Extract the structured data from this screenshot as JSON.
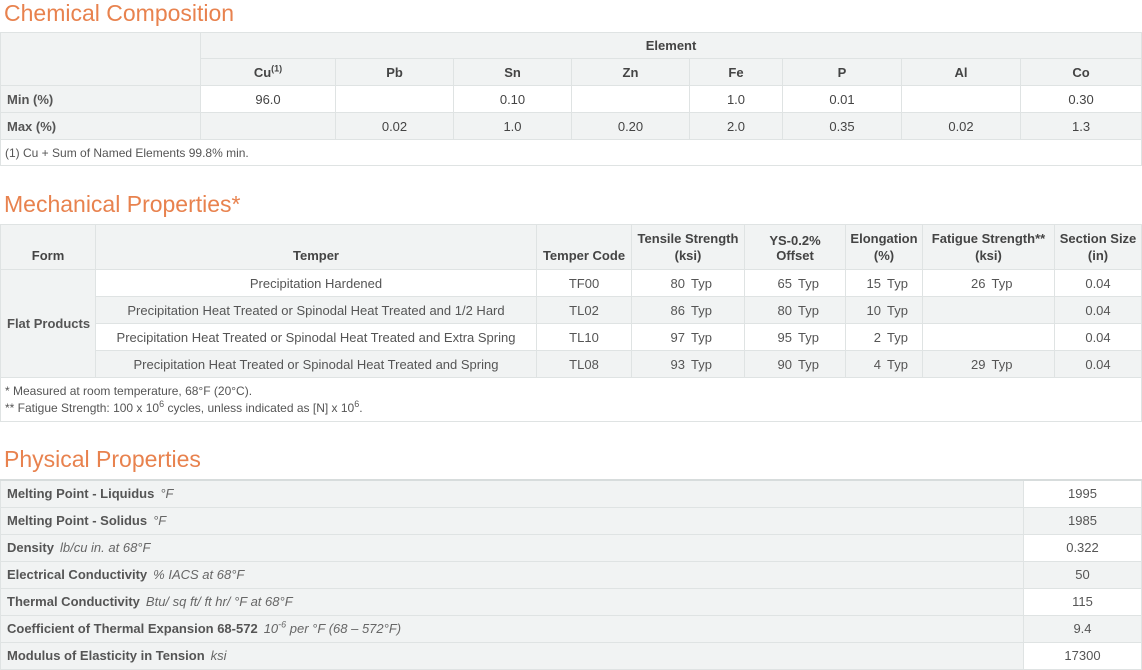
{
  "chem": {
    "title": "Chemical Composition",
    "group_header": "Element",
    "columns": [
      {
        "sym": "Cu",
        "sup": "(1)"
      },
      {
        "sym": "Pb",
        "sup": ""
      },
      {
        "sym": "Sn",
        "sup": ""
      },
      {
        "sym": "Zn",
        "sup": ""
      },
      {
        "sym": "Fe",
        "sup": ""
      },
      {
        "sym": "P",
        "sup": ""
      },
      {
        "sym": "Al",
        "sup": ""
      },
      {
        "sym": "Co",
        "sup": ""
      }
    ],
    "rows": [
      {
        "label": "Min (%)",
        "values": [
          "96.0",
          "",
          "0.10",
          "",
          "1.0",
          "0.01",
          "",
          "0.30"
        ]
      },
      {
        "label": "Max (%)",
        "values": [
          "",
          "0.02",
          "1.0",
          "0.20",
          "2.0",
          "0.35",
          "0.02",
          "1.3"
        ]
      }
    ],
    "footnote": "(1) Cu + Sum of Named Elements 99.8% min."
  },
  "mech": {
    "title": "Mechanical Properties*",
    "headers": {
      "form": "Form",
      "temper": "Temper",
      "temper_code": "Temper Code",
      "tensile_1": "Tensile Strength",
      "tensile_2": "(ksi)",
      "ys": "YS-0.2% Offset",
      "elong_1": "Elongation",
      "elong_2": "(%)",
      "fatigue_1": "Fatigue Strength**",
      "fatigue_2": "(ksi)",
      "section_1": "Section Size",
      "section_2": "(in)"
    },
    "form": "Flat Products",
    "rows": [
      {
        "temper": "Precipitation Hardened",
        "code": "TF00",
        "tensile": "80",
        "tensile_typ": "Typ",
        "ys": "65",
        "ys_typ": "Typ",
        "elong": "15",
        "elong_typ": "Typ",
        "fatigue": "26",
        "fatigue_typ": "Typ",
        "section": "0.04"
      },
      {
        "temper": "Precipitation Heat Treated or Spinodal Heat Treated and 1/2 Hard",
        "code": "TL02",
        "tensile": "86",
        "tensile_typ": "Typ",
        "ys": "80",
        "ys_typ": "Typ",
        "elong": "10",
        "elong_typ": "Typ",
        "fatigue": "",
        "fatigue_typ": "",
        "section": "0.04"
      },
      {
        "temper": "Precipitation Heat Treated or Spinodal Heat Treated and Extra Spring",
        "code": "TL10",
        "tensile": "97",
        "tensile_typ": "Typ",
        "ys": "95",
        "ys_typ": "Typ",
        "elong": "2",
        "elong_typ": "Typ",
        "fatigue": "",
        "fatigue_typ": "",
        "section": "0.04"
      },
      {
        "temper": "Precipitation Heat Treated or Spinodal Heat Treated and Spring",
        "code": "TL08",
        "tensile": "93",
        "tensile_typ": "Typ",
        "ys": "90",
        "ys_typ": "Typ",
        "elong": "4",
        "elong_typ": "Typ",
        "fatigue": "29",
        "fatigue_typ": "Typ",
        "section": "0.04"
      }
    ],
    "note1": "* Measured at room temperature, 68°F (20°C).",
    "note2_a": "** Fatigue Strength: 100 x 10",
    "note2_sup1": "6",
    "note2_b": " cycles, unless indicated as [N] x 10",
    "note2_sup2": "6",
    "note2_c": "."
  },
  "phys": {
    "title": "Physical Properties",
    "rows": [
      {
        "label": "Melting Point - Liquidus",
        "unit": "°F",
        "unit_sup": "",
        "unit_rest": "",
        "value": "1995"
      },
      {
        "label": "Melting Point - Solidus",
        "unit": "°F",
        "unit_sup": "",
        "unit_rest": "",
        "value": "1985"
      },
      {
        "label": "Density",
        "unit": "lb/cu in. at 68°F",
        "unit_sup": "",
        "unit_rest": "",
        "value": "0.322"
      },
      {
        "label": "Electrical Conductivity",
        "unit": "% IACS at 68°F",
        "unit_sup": "",
        "unit_rest": "",
        "value": "50"
      },
      {
        "label": "Thermal Conductivity",
        "unit": "Btu/ sq ft/ ft hr/ °F at 68°F",
        "unit_sup": "",
        "unit_rest": "",
        "value": "115"
      },
      {
        "label": "Coefficient of Thermal Expansion 68-572",
        "unit": "10",
        "unit_sup": "-6",
        "unit_rest": " per °F (68 – 572°F)",
        "value": "9.4"
      },
      {
        "label": "Modulus of Elasticity in Tension",
        "unit": "ksi",
        "unit_sup": "",
        "unit_rest": "",
        "value": "17300"
      }
    ]
  }
}
